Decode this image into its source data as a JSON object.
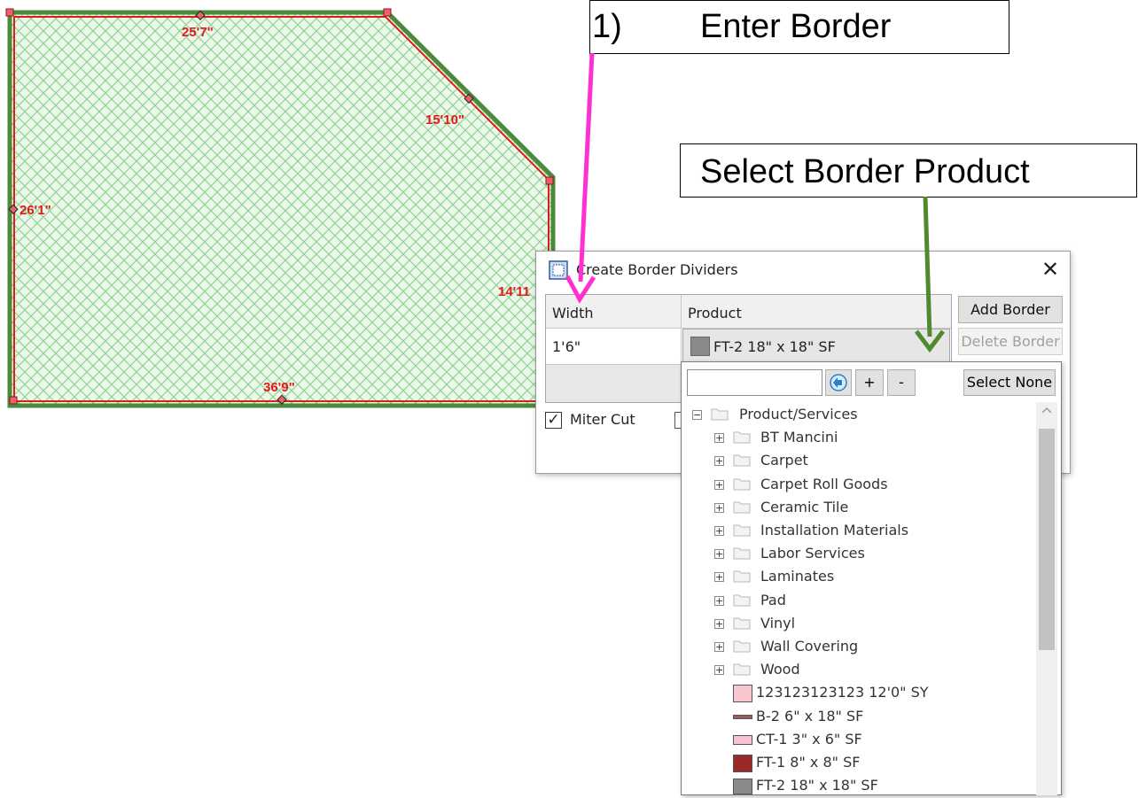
{
  "floor_plan": {
    "dimensions": [
      "25'7\"",
      "15'10\"",
      "26'1\"",
      "14'11",
      "36'9\""
    ],
    "colors": {
      "fill_hatch": "#8fd38f",
      "outline": "#4a8a3a",
      "border_line": "#e01b1b"
    }
  },
  "callouts": {
    "enter_border": {
      "number": "1)",
      "text": "Enter Border"
    },
    "select_product": {
      "text": "Select Border Product"
    },
    "colors": {
      "pink_arrow": "#ff2fd1",
      "green_arrow": "#4f8a2c"
    }
  },
  "dialog": {
    "title": "Create Border Dividers",
    "close_label": "✕",
    "grid": {
      "col_width": "Width",
      "col_product": "Product",
      "row_width_value": "1'6\"",
      "row_product_value": "FT-2 18\" x 18\" SF"
    },
    "add_border": "Add Border",
    "delete_border": "Delete Border",
    "miter_cut": "Miter Cut",
    "miter_checked": "✓"
  },
  "dropdown": {
    "search_value": "",
    "back_icon": "back-arrow-icon",
    "plus_label": "+",
    "minus_label": "-",
    "select_none": "Select None",
    "root": "Product/Services",
    "folders": [
      "BT Mancini",
      "Carpet",
      "Carpet Roll Goods",
      "Ceramic Tile",
      "Installation Materials",
      "Labor Services",
      "Laminates",
      "Pad",
      "Vinyl",
      "Wall Covering",
      "Wood"
    ],
    "products": [
      {
        "label": "123123123123 12'0\" SY",
        "color": "#f8c6cf"
      },
      {
        "label": "B-2 6\" x 18\" SF",
        "color": "#a05a5a"
      },
      {
        "label": "CT-1 3\" x 6\" SF",
        "color": "#f7c2d0"
      },
      {
        "label": "FT-1 8\" x 8\" SF",
        "color": "#9a2a2a"
      },
      {
        "label": "FT-2 18\" x 18\" SF",
        "color": "#8a8a8a"
      }
    ]
  }
}
